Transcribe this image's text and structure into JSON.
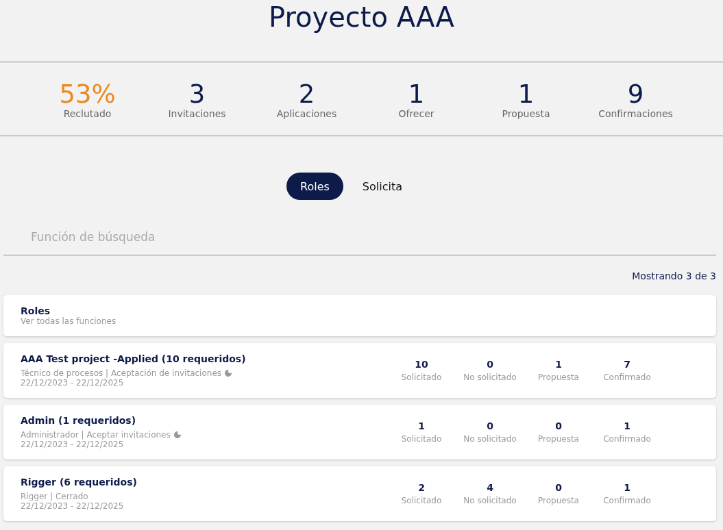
{
  "title": "Proyecto AAA",
  "stats": [
    {
      "value": "53%",
      "label": "Reclutado",
      "color": "#ea8a1c"
    },
    {
      "value": "3",
      "label": "Invitaciones",
      "color": "#0d1b4a"
    },
    {
      "value": "2",
      "label": "Aplicaciones",
      "color": "#0d1b4a"
    },
    {
      "value": "1",
      "label": "Ofrecer",
      "color": "#0d1b4a"
    },
    {
      "value": "1",
      "label": "Propuesta",
      "color": "#0d1b4a"
    },
    {
      "value": "9",
      "label": "Confirmaciones",
      "color": "#0d1b4a"
    }
  ],
  "tabs": [
    {
      "label": "Roles",
      "selected": true
    },
    {
      "label": "Solicita",
      "selected": false
    }
  ],
  "search": {
    "placeholder": "Función de búsqueda"
  },
  "count": "Mostrando 3 de 3",
  "header_card": {
    "title": "Roles",
    "subtitle": "Ver todas las funciones"
  },
  "roles": [
    {
      "title": "AAA Test project -Applied (10 requeridos)",
      "details": "Técnico de procesos | Aceptación de invitaciones",
      "moon_icon": true,
      "dates": "22/12/2023 - 22/12/2025",
      "metrics": [
        {
          "value": "10",
          "label": "Solicitado"
        },
        {
          "value": "0",
          "label": "No solicitado"
        },
        {
          "value": "1",
          "label": "Propuesta"
        },
        {
          "value": "7",
          "label": "Confirmado"
        }
      ]
    },
    {
      "title": "Admin (1 requeridos)",
      "details": "Administrador | Aceptar invitaciones",
      "moon_icon": true,
      "dates": "22/12/2023 - 22/12/2025",
      "metrics": [
        {
          "value": "1",
          "label": "Solicitado"
        },
        {
          "value": "0",
          "label": "No solicitado"
        },
        {
          "value": "0",
          "label": "Propuesta"
        },
        {
          "value": "1",
          "label": "Confirmado"
        }
      ]
    },
    {
      "title": "Rigger (6 requeridos)",
      "details": "Rigger | Cerrado",
      "moon_icon": false,
      "dates": "22/12/2023 - 22/12/2025",
      "metrics": [
        {
          "value": "2",
          "label": "Solicitado"
        },
        {
          "value": "4",
          "label": "No solicitado"
        },
        {
          "value": "0",
          "label": "Propuesta"
        },
        {
          "value": "1",
          "label": "Confirmado"
        }
      ]
    }
  ]
}
